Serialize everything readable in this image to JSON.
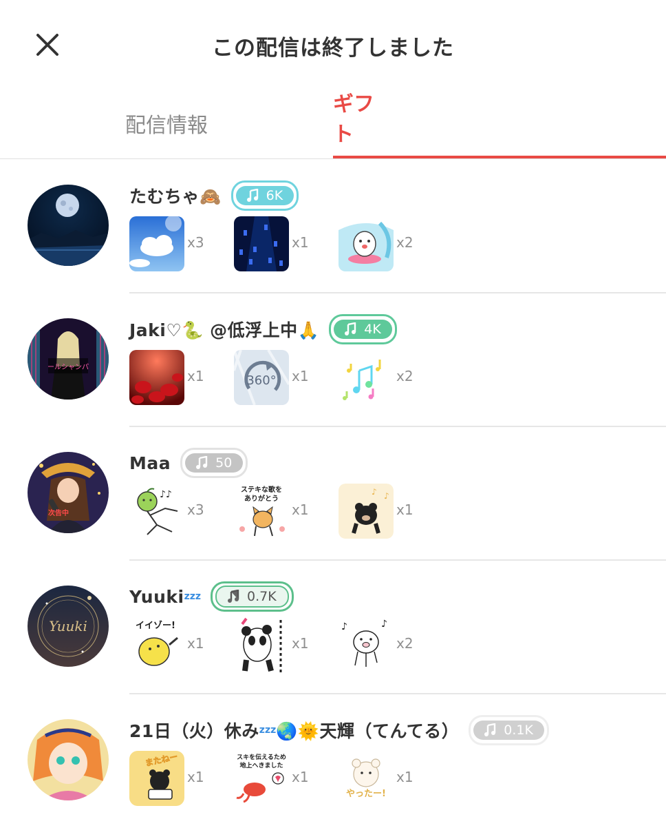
{
  "header": {
    "title": "この配信は終了しました",
    "close_icon": "close-icon"
  },
  "tabs": [
    {
      "label": "配信情報",
      "active": false
    },
    {
      "label": "ギフト",
      "active": true
    }
  ],
  "colors": {
    "accent": "#e94a45",
    "text": "#333333",
    "muted": "#8f8f8f"
  },
  "rows": [
    {
      "name": "たむちゃ🙈",
      "badge": "6K",
      "gifts": [
        {
          "icon": "sky-clouds-gift",
          "qty": "x3"
        },
        {
          "icon": "blue-light-rain-gift",
          "qty": "x1"
        },
        {
          "icon": "surfing-dog-gift",
          "qty": "x2"
        }
      ]
    },
    {
      "name": "Jaki♡🐍 @低浮上中🙏",
      "badge": "4K",
      "gifts": [
        {
          "icon": "red-flowers-gift",
          "qty": "x1"
        },
        {
          "icon": "360-rotate-gift",
          "qty": "x1"
        },
        {
          "icon": "music-notes-gift",
          "qty": "x2"
        }
      ]
    },
    {
      "name": "Maa",
      "badge": "50",
      "gifts": [
        {
          "icon": "dancing-apple-gift",
          "qty": "x3"
        },
        {
          "text": "ステキな歌をありがとう",
          "icon": "shiba-dog-gift",
          "qty": "x1"
        },
        {
          "icon": "singing-bear-gift",
          "qty": "x1"
        }
      ]
    },
    {
      "name": "Yuuki",
      "name_suffix": "zzz",
      "badge": "0.7K",
      "gifts": [
        {
          "text": "イイゾー!",
          "icon": "yellow-chick-gift",
          "qty": "x1"
        },
        {
          "icon": "panda-gift",
          "qty": "x1"
        },
        {
          "icon": "dancing-pig-gift",
          "qty": "x2"
        }
      ]
    },
    {
      "name": "21日（火）休み",
      "name_suffix": "zzz",
      "name_end": "🌏🌞天輝（てんてる）",
      "badge": "0.1K",
      "gifts": [
        {
          "text": "またねー",
          "icon": "bear-phone-gift",
          "qty": "x1"
        },
        {
          "text": "スキを伝えるため地上へきました",
          "icon": "octopus-heart-gift",
          "qty": "x1"
        },
        {
          "text": "やったー!",
          "icon": "white-bear-gift",
          "qty": "x1"
        }
      ]
    }
  ]
}
